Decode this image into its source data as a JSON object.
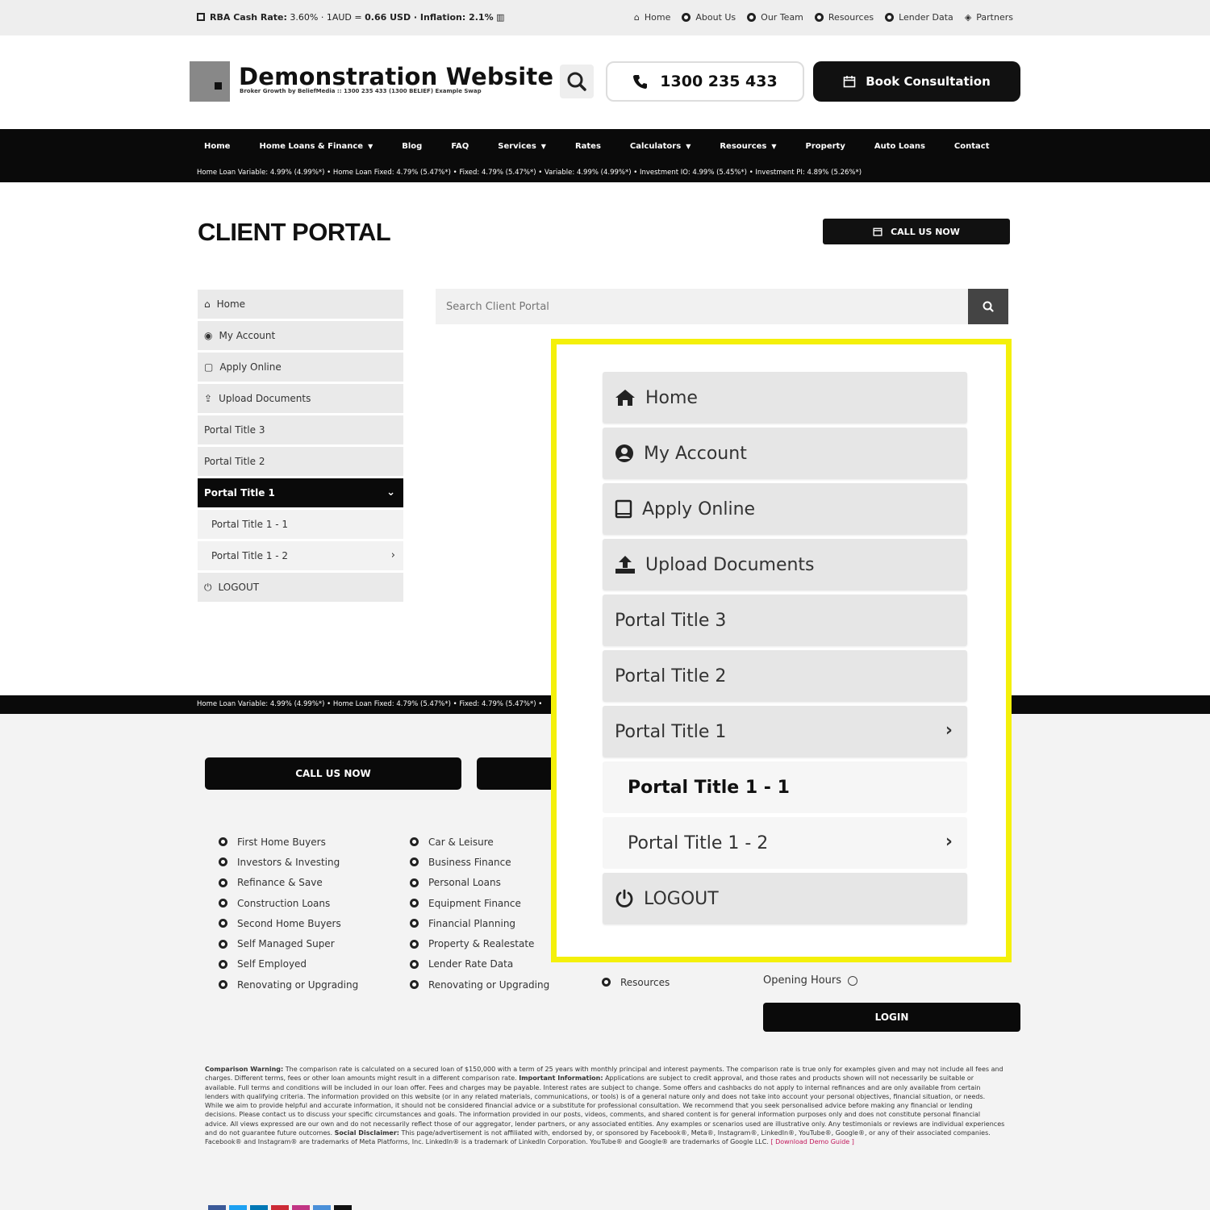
{
  "topbar": {
    "rates_label": "RBA Cash Rate:",
    "rates_value": "3.60% · 1AUD = ",
    "fx_value": "0.66 USD",
    "inflation_label": " · Inflation: 2.1%",
    "links": [
      "Home",
      "About Us",
      "Our Team",
      "Resources",
      "Lender Data",
      "Partners"
    ]
  },
  "header": {
    "title": "Demonstration Website",
    "tagline": "Broker Growth by BeliefMedia :: 1300 235 433 (1300 BELIEF) Example Swap",
    "phone": "1300 235 433",
    "book_label": "Book Consultation"
  },
  "mainnav": {
    "items": [
      "Home",
      "Home Loans & Finance",
      "Blog",
      "FAQ",
      "Services",
      "Rates",
      "Calculators",
      "Resources",
      "Property",
      "Auto Loans",
      "Contact"
    ],
    "ticker": "Home Loan Variable: 4.99% (4.99%*) • Home Loan Fixed: 4.79% (5.47%*) • Fixed: 4.79% (5.47%*) • Variable: 4.99% (4.99%*) • Investment IO: 4.99% (5.45%*) • Investment PI: 4.89% (5.26%*)"
  },
  "page": {
    "title": "CLIENT PORTAL",
    "call_label": "CALL US NOW",
    "search_placeholder": "Search Client Portal"
  },
  "sidebar": {
    "items": [
      "Home",
      "My Account",
      "Apply Online",
      "Upload Documents",
      "Portal Title 3",
      "Portal Title 2",
      "Portal Title 1",
      "Portal Title 1 - 1",
      "Portal Title 1 - 2",
      "LOGOUT"
    ]
  },
  "zoom": {
    "items": [
      "Home",
      "My Account",
      "Apply Online",
      "Upload Documents",
      "Portal Title 3",
      "Portal Title 2",
      "Portal Title 1",
      "Portal Title 1 - 1",
      "Portal Title 1 - 2",
      "LOGOUT"
    ],
    "highlight_color": "#f4f00a"
  },
  "footer": {
    "ticker": "Home Loan Variable: 4.99% (4.99%*) • Home Loan Fixed: 4.79% (5.47%*) • Fixed: 4.79% (5.47%*) •",
    "call_label": "CALL US NOW",
    "col1": [
      "First Home Buyers",
      "Investors & Investing",
      "Refinance & Save",
      "Construction Loans",
      "Second Home Buyers",
      "Self Managed Super",
      "Self Employed",
      "Renovating or Upgrading"
    ],
    "col2": [
      "Car & Leisure",
      "Business Finance",
      "Personal Loans",
      "Equipment Finance",
      "Financial Planning",
      "Property & Realestate",
      "Lender Rate Data",
      "Renovating or Upgrading"
    ],
    "col3_last": "Resources",
    "opening_hours": "Opening Hours",
    "login_label": "LOGIN",
    "disclaimer_heading": "Comparison Warning:",
    "disclaimer_body": "The comparison rate is calculated on a secured loan of $150,000 with a term of 25 years with monthly principal and interest payments. The comparison rate is true only for examples given and may not include all fees and charges. Different terms, fees or other loan amounts might result in a different comparison rate.",
    "important_heading": "Important Information:",
    "important_body": "Applications are subject to credit approval, and those rates and products shown will not necessarily be suitable or available. Full terms and conditions will be included in our loan offer. Fees and charges may be payable. Interest rates are subject to change. Some offers and cashbacks do not apply to internal refinances and are only available from certain lenders with qualifying criteria. The information provided on this website (or in any related materials, communications, or tools) is of a general nature only and does not take into account your personal objectives, financial situation, or needs. While we aim to provide helpful and accurate information, it should not be considered financial advice or a substitute for professional consultation. We recommend that you seek personalised advice before making any financial or lending decisions. Please contact us to discuss your specific circumstances and goals. The information provided in our posts, videos, comments, and shared content is for general information purposes only and does not constitute personal financial advice. All views expressed are our own and do not necessarily reflect those of our aggregator, lender partners, or any associated entities. Any examples or scenarios used are illustrative only. Any testimonials or reviews are individual experiences and do not guarantee future outcomes.",
    "social_heading": "Social Disclaimer:",
    "social_body": "This page/advertisement is not affiliated with, endorsed by, or sponsored by Facebook®, Meta®, Instagram®, LinkedIn®, YouTube®, Google®, or any of their associated companies. Facebook® and Instagram® are trademarks of Meta Platforms, Inc. LinkedIn® is a trademark of LinkedIn Corporation. YouTube® and Google® are trademarks of Google LLC.",
    "download_link": "[ Download Demo Guide ]",
    "swatch_colors": [
      "#3b5998",
      "#1da1f2",
      "#0077b5",
      "#cc2a36",
      "#c13584",
      "#4a90d9",
      "#111111"
    ]
  }
}
